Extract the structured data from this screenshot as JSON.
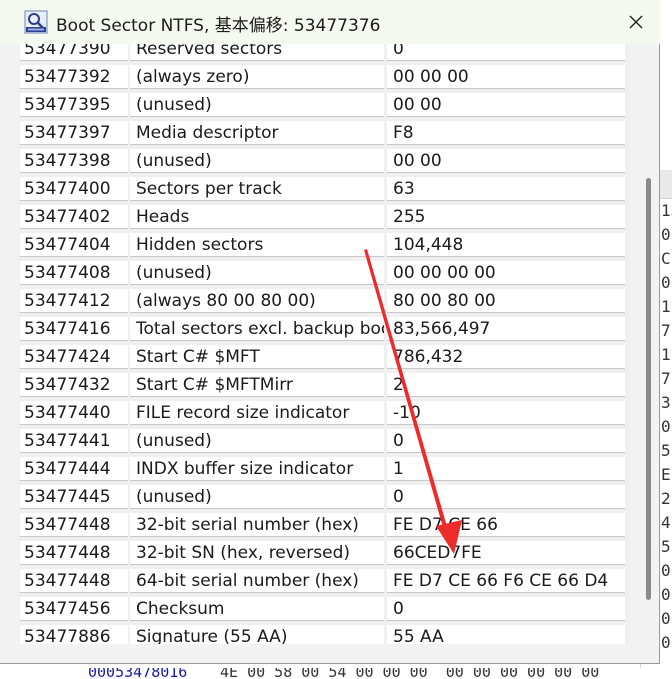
{
  "window": {
    "title": "Boot Sector NTFS, 基本偏移: 53477376",
    "icon": "hex-editor-app-icon",
    "close_glyph": "✕"
  },
  "table": {
    "partial_top_row": {
      "offset": "53477390",
      "description": "Reserved sectors",
      "value": "0"
    },
    "rows": [
      {
        "offset": "53477392",
        "description": "(always zero)",
        "value": "00 00 00"
      },
      {
        "offset": "53477395",
        "description": "(unused)",
        "value": "00 00"
      },
      {
        "offset": "53477397",
        "description": "Media descriptor",
        "value": "F8"
      },
      {
        "offset": "53477398",
        "description": "(unused)",
        "value": "00 00"
      },
      {
        "offset": "53477400",
        "description": "Sectors per track",
        "value": "63"
      },
      {
        "offset": "53477402",
        "description": "Heads",
        "value": "255"
      },
      {
        "offset": "53477404",
        "description": "Hidden sectors",
        "value": "104,448"
      },
      {
        "offset": "53477408",
        "description": "(unused)",
        "value": "00 00 00 00"
      },
      {
        "offset": "53477412",
        "description": "(always 80 00 80 00)",
        "value": "80 00 80 00"
      },
      {
        "offset": "53477416",
        "description": "Total sectors excl. backup boot sector",
        "value": "83,566,497"
      },
      {
        "offset": "53477424",
        "description": "Start C# $MFT",
        "value": "786,432"
      },
      {
        "offset": "53477432",
        "description": "Start C# $MFTMirr",
        "value": "2"
      },
      {
        "offset": "53477440",
        "description": "FILE record size indicator",
        "value": "-10"
      },
      {
        "offset": "53477441",
        "description": "(unused)",
        "value": "0"
      },
      {
        "offset": "53477444",
        "description": "INDX buffer size indicator",
        "value": "1"
      },
      {
        "offset": "53477445",
        "description": "(unused)",
        "value": "0"
      },
      {
        "offset": "53477448",
        "description": "32-bit serial number (hex)",
        "value": "FE D7 CE 66"
      },
      {
        "offset": "53477448",
        "description": "32-bit SN (hex, reversed)",
        "value": "66CED7FE"
      },
      {
        "offset": "53477448",
        "description": "64-bit serial number (hex)",
        "value": "FE D7 CE 66 F6 CE 66 D4"
      },
      {
        "offset": "53477456",
        "description": "Checksum",
        "value": "0"
      },
      {
        "offset": "53477886",
        "description": "Signature (55 AA)",
        "value": "55 AA"
      }
    ]
  },
  "background_editor": {
    "right_column_fragments": [
      "13",
      "0",
      "C",
      "0",
      "1",
      "7",
      "1",
      "7",
      "3",
      "0",
      "5",
      "E",
      "2",
      "4",
      "5",
      "0",
      "0",
      "0",
      "0"
    ],
    "bottom_row": {
      "offset": "00053478016",
      "hex": "4E 00 58 00 54 00 00 00  00 00 00 00 00 00"
    }
  },
  "colors": {
    "titlebar": "#f5faf1",
    "dialog_bg": "#f3f3f3",
    "cell_bg": "#ffffff",
    "annotation_arrow": "#ee2b2b"
  }
}
